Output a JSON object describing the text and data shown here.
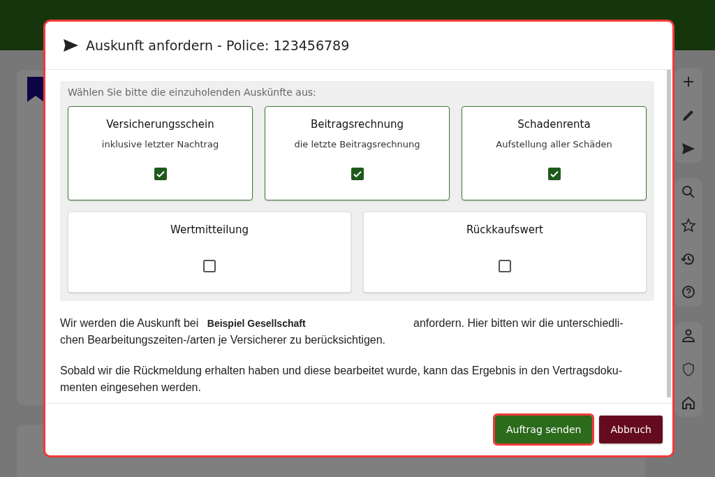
{
  "dialog": {
    "title": "Auskunft anfordern - Police: 123456789",
    "prompt": "Wählen Sie bitte die einzuholenden Auskünfte aus:",
    "options": [
      {
        "title": "Versicherungsschein",
        "subtitle": "inklusive letzter Nachtrag",
        "checked": true
      },
      {
        "title": "Beitragsrechnung",
        "subtitle": "die letzte Beitragsrechnung",
        "checked": true
      },
      {
        "title": "Schadenrenta",
        "subtitle": "Aufstellung aller Schäden",
        "checked": true
      },
      {
        "title": "Wertmitteilung",
        "checked": false
      },
      {
        "title": "Rückkaufswert",
        "checked": false
      }
    ],
    "paragraphs": [
      {
        "lines": [
          "Wir werden die Auskunft bei **Beispiel Gesellschaft** anfordern. Hier bitten wir die unterschiedli-",
          "chen Bearbeitungszeiten-/arten je Versicherer zu berücksichtigen."
        ]
      },
      {
        "lines": [
          "Sobald wir die Rückmeldung erhalten haben und diese bearbeitet wurde, kann das Ergebnis in den Vertragsdoku-",
          "menten eingesehen werden."
        ]
      }
    ],
    "buttons": [
      {
        "label": "Auftrag senden",
        "kind": "primary"
      },
      {
        "label": "Abbruch",
        "kind": "cancel"
      }
    ]
  }
}
